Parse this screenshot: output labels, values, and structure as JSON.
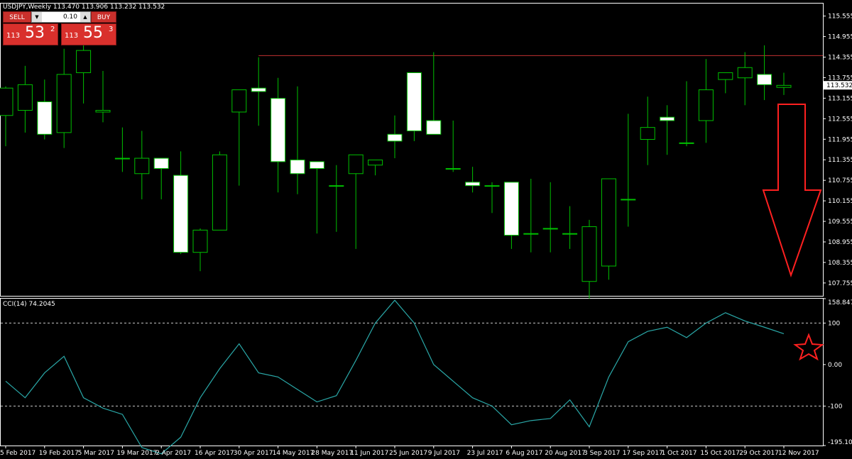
{
  "header": {
    "symbol_info": "USDJPY,Weekly  113.470 113.906 113.232 113.532"
  },
  "trade_panel": {
    "sell_label": "SELL",
    "buy_label": "BUY",
    "lot": "0.10",
    "sell_big": "113",
    "sell_pips": "53",
    "sell_sup": "2",
    "buy_big": "113",
    "buy_pips": "55",
    "buy_sup": "3"
  },
  "colors": {
    "bull_outline": "#00c000",
    "bear_fill": "#ffffff",
    "cci_line": "#2aa8a8",
    "level_line": "#c03030",
    "annotation": "#ff2020"
  },
  "chart_data": [
    {
      "type": "candlestick",
      "x": [
        "5 Feb 2017",
        "12 Feb 2017",
        "19 Feb 2017",
        "26 Feb 2017",
        "5 Mar 2017",
        "12 Mar 2017",
        "19 Mar 2017",
        "26 Mar 2017",
        "2 Apr 2017",
        "9 Apr 2017",
        "16 Apr 2017",
        "23 Apr 2017",
        "30 Apr 2017",
        "7 May 2017",
        "14 May 2017",
        "21 May 2017",
        "28 May 2017",
        "4 Jun 2017",
        "11 Jun 2017",
        "18 Jun 2017",
        "25 Jun 2017",
        "2 Jul 2017",
        "9 Jul 2017",
        "16 Jul 2017",
        "23 Jul 2017",
        "30 Jul 2017",
        "6 Aug 2017",
        "13 Aug 2017",
        "20 Aug 2017",
        "27 Aug 2017",
        "3 Sep 2017",
        "10 Sep 2017",
        "17 Sep 2017",
        "24 Sep 2017",
        "1 Oct 2017",
        "8 Oct 2017",
        "15 Oct 2017",
        "22 Oct 2017",
        "29 Oct 2017",
        "5 Nov 2017",
        "12 Nov 2017"
      ],
      "open": [
        112.65,
        112.8,
        113.05,
        112.15,
        113.9,
        112.75,
        111.4,
        110.95,
        111.4,
        110.9,
        108.65,
        109.3,
        112.75,
        113.45,
        113.15,
        111.35,
        111.3,
        110.6,
        110.95,
        111.2,
        112.1,
        113.9,
        112.5,
        111.1,
        110.7,
        110.6,
        110.7,
        109.2,
        109.35,
        109.2,
        107.8,
        108.25,
        110.2,
        111.95,
        112.6,
        111.85,
        112.5,
        113.7,
        113.75,
        113.85,
        113.47
      ],
      "close": [
        113.45,
        113.55,
        112.1,
        113.85,
        114.55,
        112.8,
        111.4,
        111.4,
        111.1,
        108.65,
        109.3,
        111.5,
        113.4,
        113.35,
        111.3,
        110.95,
        111.1,
        110.6,
        111.5,
        111.35,
        111.9,
        112.2,
        112.1,
        111.1,
        110.6,
        110.6,
        109.15,
        109.2,
        109.35,
        109.2,
        109.4,
        110.8,
        110.2,
        112.3,
        112.5,
        111.85,
        113.4,
        113.9,
        114.05,
        113.55,
        113.53
      ],
      "high": [
        113.5,
        114.1,
        113.7,
        114.6,
        114.75,
        113.95,
        112.3,
        112.2,
        111.4,
        111.6,
        109.35,
        111.6,
        112.8,
        114.35,
        113.75,
        113.5,
        111.3,
        111.2,
        110.95,
        111.3,
        112.65,
        113.9,
        114.5,
        112.5,
        111.15,
        110.7,
        110.7,
        110.8,
        110.7,
        110.0,
        109.6,
        110.0,
        112.7,
        113.2,
        112.95,
        113.65,
        114.3,
        113.9,
        114.5,
        114.7,
        113.9
      ],
      "low": [
        111.75,
        112.15,
        111.95,
        111.7,
        113.0,
        112.45,
        111.0,
        110.2,
        110.2,
        108.6,
        108.1,
        109.55,
        110.6,
        112.35,
        110.4,
        110.35,
        109.2,
        109.25,
        108.75,
        110.9,
        111.4,
        111.9,
        112.2,
        111.0,
        110.4,
        109.8,
        108.75,
        108.65,
        108.65,
        108.75,
        107.3,
        107.85,
        109.4,
        111.2,
        111.5,
        111.75,
        111.85,
        113.3,
        112.95,
        113.1,
        113.25
      ],
      "ylim": [
        107.4,
        115.9
      ],
      "yticks": [
        "115.555",
        "114.955",
        "114.355",
        "113.755",
        "113.155",
        "112.555",
        "111.955",
        "111.355",
        "110.755",
        "110.155",
        "109.555",
        "108.955",
        "108.355",
        "107.755"
      ],
      "current_price": "113.532",
      "level_line": 114.4
    },
    {
      "type": "line",
      "title": "CCI(14) 74.2045",
      "x": [
        "5 Feb 2017",
        "12 Feb 2017",
        "19 Feb 2017",
        "26 Feb 2017",
        "5 Mar 2017",
        "12 Mar 2017",
        "19 Mar 2017",
        "26 Mar 2017",
        "2 Apr 2017",
        "9 Apr 2017",
        "16 Apr 2017",
        "23 Apr 2017",
        "30 Apr 2017",
        "7 May 2017",
        "14 May 2017",
        "21 May 2017",
        "28 May 2017",
        "4 Jun 2017",
        "11 Jun 2017",
        "18 Jun 2017",
        "25 Jun 2017",
        "2 Jul 2017",
        "9 Jul 2017",
        "16 Jul 2017",
        "23 Jul 2017",
        "30 Jul 2017",
        "6 Aug 2017",
        "13 Aug 2017",
        "20 Aug 2017",
        "27 Aug 2017",
        "3 Sep 2017",
        "10 Sep 2017",
        "17 Sep 2017",
        "24 Sep 2017",
        "1 Oct 2017",
        "8 Oct 2017",
        "15 Oct 2017",
        "22 Oct 2017",
        "29 Oct 2017",
        "5 Nov 2017",
        "12 Nov 2017"
      ],
      "values": [
        -40,
        -80,
        -20,
        20,
        -80,
        -105,
        -120,
        -200,
        -215,
        -175,
        -80,
        -10,
        50,
        -20,
        -30,
        -60,
        -90,
        -75,
        10,
        100,
        155,
        100,
        0,
        -40,
        -80,
        -100,
        -145,
        -135,
        -130,
        -85,
        -150,
        -30,
        55,
        80,
        90,
        65,
        100,
        125,
        105,
        90,
        74.2
      ],
      "ylim": [
        -195.1,
        158.8
      ],
      "yticks": [
        "158.847",
        "100",
        "0.00",
        "-100",
        "-195.1053"
      ],
      "dashed_levels": [
        100,
        -100
      ]
    }
  ],
  "xaxis_labels": [
    "5 Feb 2017",
    "19 Feb 2017",
    "5 Mar 2017",
    "19 Mar 2017",
    "2 Apr 2017",
    "16 Apr 2017",
    "30 Apr 2017",
    "14 May 2017",
    "28 May 2017",
    "11 Jun 2017",
    "25 Jun 2017",
    "9 Jul 2017",
    "23 Jul 2017",
    "6 Aug 2017",
    "20 Aug 2017",
    "3 Sep 2017",
    "17 Sep 2017",
    "1 Oct 2017",
    "15 Oct 2017",
    "29 Oct 2017",
    "12 Nov 2017"
  ],
  "annotations": {
    "arrow": "down-arrow-icon",
    "star": "star-icon"
  }
}
